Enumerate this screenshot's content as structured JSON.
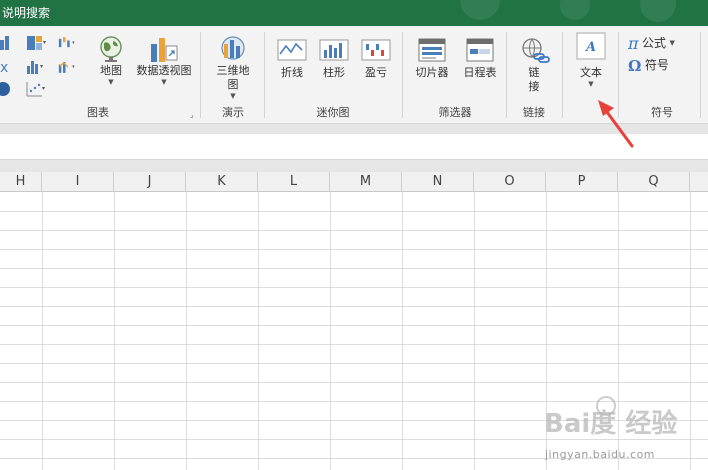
{
  "titlebar": {
    "search_text": "说明搜索"
  },
  "ribbon": {
    "groups": {
      "charts": {
        "label": "图表",
        "map": "地图",
        "pivot_chart": "数据透视图"
      },
      "tours": {
        "label": "演示",
        "map3d_line1": "三维地",
        "map3d_line2": "图"
      },
      "sparklines": {
        "label": "迷你图",
        "line": "折线",
        "column": "柱形",
        "win_loss": "盈亏"
      },
      "filters": {
        "label": "筛选器",
        "slicer": "切片器",
        "timeline": "日程表"
      },
      "links": {
        "label": "链接",
        "link_line1": "链",
        "link_line2": "接"
      },
      "text": {
        "label": "文本"
      },
      "symbols": {
        "label": "符号",
        "equation": "公式",
        "symbol": "符号"
      }
    }
  },
  "columns": [
    "H",
    "I",
    "J",
    "K",
    "L",
    "M",
    "N",
    "O",
    "P",
    "Q"
  ],
  "watermark": {
    "logo": "Bai度 经验",
    "url": "jingyan.baidu.com"
  },
  "colors": {
    "excel_green": "#217346",
    "arrow_red": "#e8403a"
  }
}
